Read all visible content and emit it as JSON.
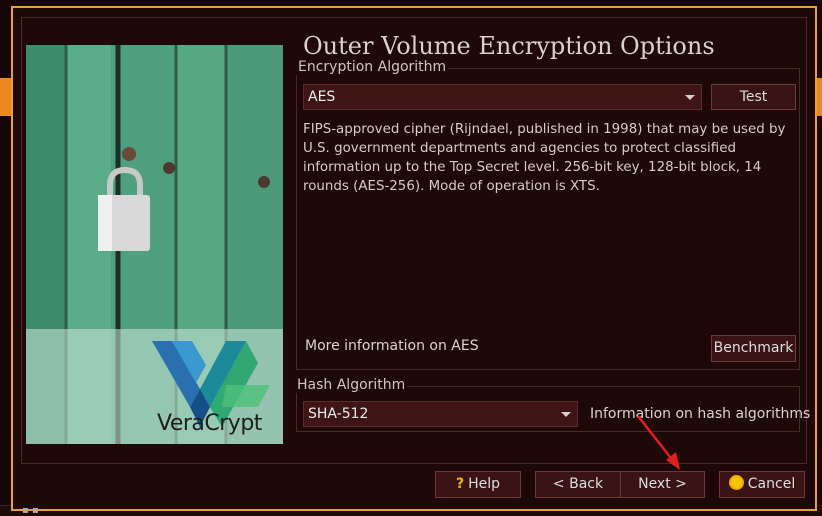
{
  "title": "Outer Volume Encryption Options",
  "encryption": {
    "group_label": "Encryption Algorithm",
    "selected": "AES",
    "test_label": "Test",
    "description": "FIPS-approved cipher (Rijndael, published in 1998) that may be used by U.S. government departments and agencies to protect classified information up to the Top Secret level. 256-bit key, 128-bit block, 14 rounds (AES-256). Mode of operation is XTS.",
    "more_info": "More information on AES",
    "benchmark_label": "Benchmark"
  },
  "hash": {
    "group_label": "Hash Algorithm",
    "selected": "SHA-512",
    "info_label": "Information on hash algorithms"
  },
  "buttons": {
    "help": "Help",
    "back": "< Back",
    "next": "Next >",
    "cancel": "Cancel"
  },
  "brand": {
    "logo_text": "VeraCrypt"
  },
  "colors": {
    "accent_border": "#e8a13a",
    "window_bg": "#1e0808",
    "arrow": "#e02020"
  }
}
